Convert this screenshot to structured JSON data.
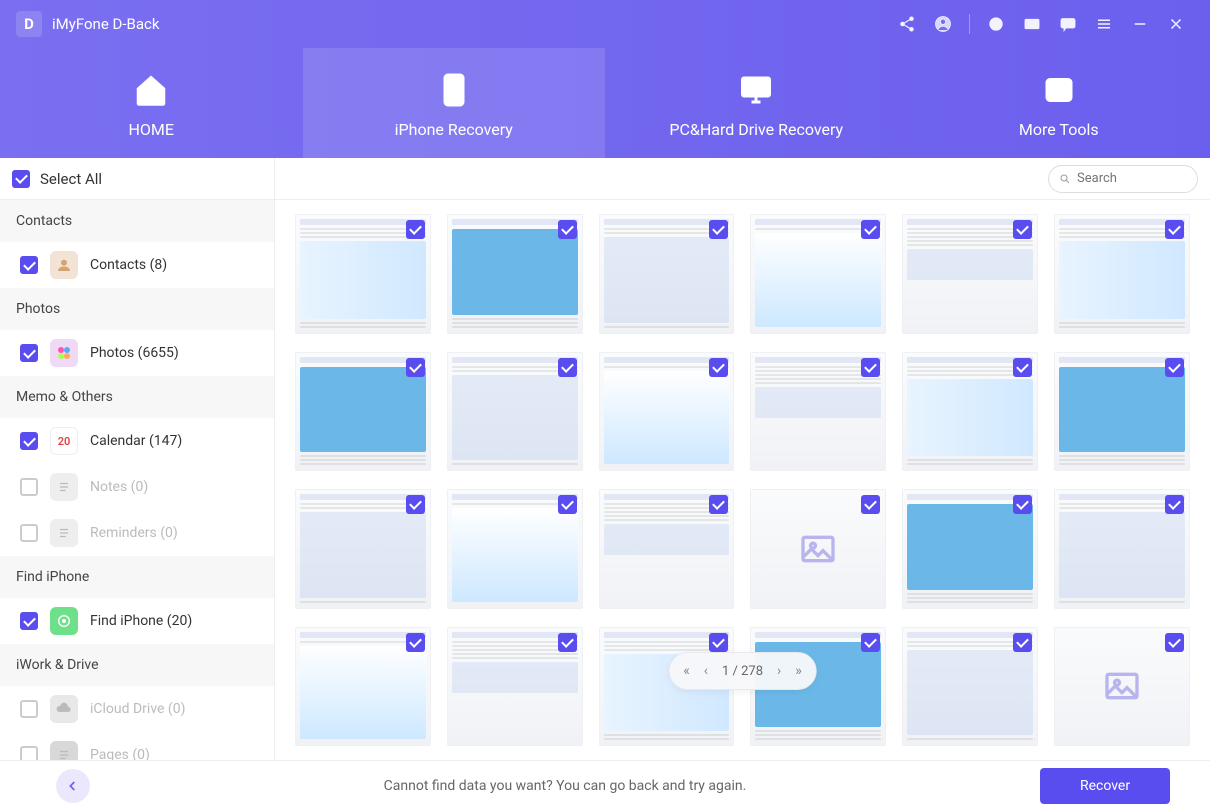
{
  "app": {
    "title": "iMyFone D-Back",
    "logo_letter": "D"
  },
  "titlebar_icons": [
    "share-icon",
    "user-icon",
    "target-icon",
    "mail-icon",
    "chat-icon",
    "menu-icon",
    "minimize-icon",
    "close-icon"
  ],
  "nav": {
    "tabs": [
      {
        "id": "home",
        "label": "HOME",
        "icon": "home-icon"
      },
      {
        "id": "iphone",
        "label": "iPhone Recovery",
        "icon": "phone-refresh-icon"
      },
      {
        "id": "pc",
        "label": "PC&Hard Drive Recovery",
        "icon": "monitor-icon"
      },
      {
        "id": "tools",
        "label": "More Tools",
        "icon": "more-icon"
      }
    ],
    "active": "iphone"
  },
  "select_all": {
    "label": "Select All",
    "checked": true
  },
  "sidebar": {
    "groups": [
      {
        "header": "Contacts",
        "items": [
          {
            "label": "Contacts (8)",
            "checked": true,
            "icon_bg": "#f2e3d5",
            "icon_name": "contacts-icon"
          }
        ]
      },
      {
        "header": "Photos",
        "items": [
          {
            "label": "Photos (6655)",
            "checked": true,
            "icon_bg": "#f0d9f5",
            "icon_name": "photos-icon"
          }
        ]
      },
      {
        "header": "Memo & Others",
        "items": [
          {
            "label": "Calendar (147)",
            "checked": true,
            "icon_bg": "#ffffff",
            "icon_name": "calendar-icon",
            "icon_text": "20",
            "icon_color": "#d44"
          },
          {
            "label": "Notes (0)",
            "checked": false,
            "disabled": true,
            "icon_bg": "#eee",
            "icon_name": "notes-icon"
          },
          {
            "label": "Reminders (0)",
            "checked": false,
            "disabled": true,
            "icon_bg": "#eee",
            "icon_name": "reminders-icon"
          }
        ]
      },
      {
        "header": "Find iPhone",
        "items": [
          {
            "label": "Find iPhone (20)",
            "checked": true,
            "icon_bg": "#6ee08a",
            "icon_name": "find-iphone-icon"
          }
        ]
      },
      {
        "header": "iWork & Drive",
        "items": [
          {
            "label": "iCloud Drive (0)",
            "checked": false,
            "disabled": true,
            "icon_bg": "#e8e8e8",
            "icon_name": "cloud-icon"
          },
          {
            "label": "Pages (0)",
            "checked": false,
            "disabled": true,
            "icon_bg": "#d8d8d8",
            "icon_name": "pages-icon"
          }
        ]
      }
    ]
  },
  "search": {
    "placeholder": "Search"
  },
  "grid": {
    "count": 24,
    "all_checked": true,
    "placeholder_indices": [
      15,
      23
    ]
  },
  "pager": {
    "current": 1,
    "total": 278,
    "text": "1 / 278"
  },
  "footer": {
    "message": "Cannot find data you want? You can go back and try again.",
    "recover_label": "Recover"
  }
}
